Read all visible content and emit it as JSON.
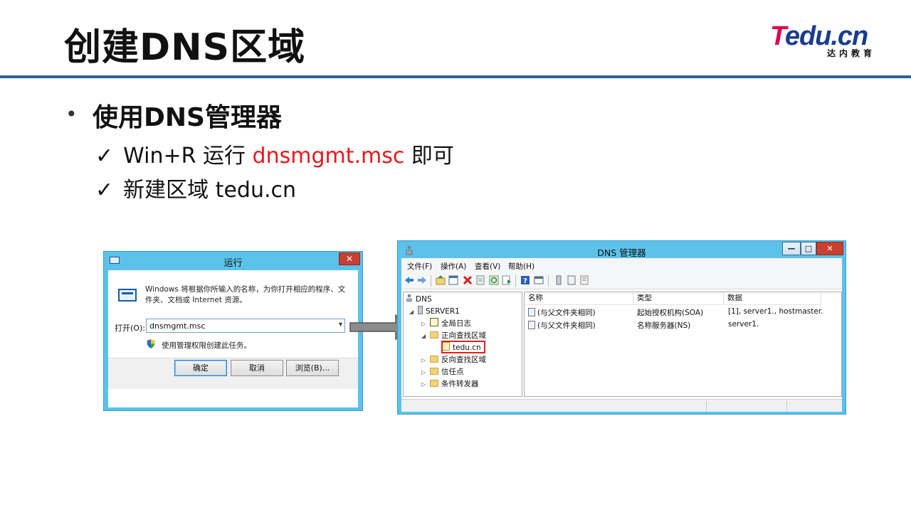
{
  "slide": {
    "title": "创建DNS区域",
    "logo": {
      "brand_t": "T",
      "brand_rest": "edu.cn",
      "sub": "达内教育"
    },
    "bullet": "使用DNS管理器",
    "sub_items": [
      {
        "check": "✓",
        "prefix": "Win+R 运行 ",
        "highlight": "dnsmgmt.msc",
        "suffix": " 即可"
      },
      {
        "check": "✓",
        "text": "新建区域 tedu.cn"
      }
    ]
  },
  "run_dialog": {
    "title": "运行",
    "close": "✕",
    "description": "Windows 将根据你所输入的名称，为你打开相应的程序、文件夹、文档或 Internet 资源。",
    "open_label": "打开(O):",
    "open_value": "dnsmgmt.msc",
    "admin_note": "使用管理权限创建此任务。",
    "buttons": {
      "ok": "确定",
      "cancel": "取消",
      "browse": "浏览(B)..."
    }
  },
  "dns_window": {
    "title": "DNS 管理器",
    "controls": {
      "minimize": "—",
      "maximize": "□",
      "close": "✕"
    },
    "menu": [
      "文件(F)",
      "操作(A)",
      "查看(V)",
      "帮助(H)"
    ],
    "tree": {
      "root": "DNS",
      "server": "SERVER1",
      "global_log": "全局日志",
      "forward_zones": "正向查找区域",
      "zone": "tedu.cn",
      "reverse_zones": "反向查找区域",
      "trust_points": "信任点",
      "forwarders": "条件转发器"
    },
    "columns": [
      "名称",
      "类型",
      "数据"
    ],
    "records": [
      {
        "name": "(与父文件夹相同)",
        "type": "起始授权机构(SOA)",
        "data": "[1], server1., hostmaster."
      },
      {
        "name": "(与父文件夹相同)",
        "type": "名称服务器(NS)",
        "data": "server1."
      }
    ]
  },
  "colors": {
    "accent_red": "#e8191c",
    "header_rule": "#2a6496",
    "window_frame": "#5cc2ea",
    "logo_pink": "#e0004f",
    "logo_blue": "#1b3c8f"
  }
}
